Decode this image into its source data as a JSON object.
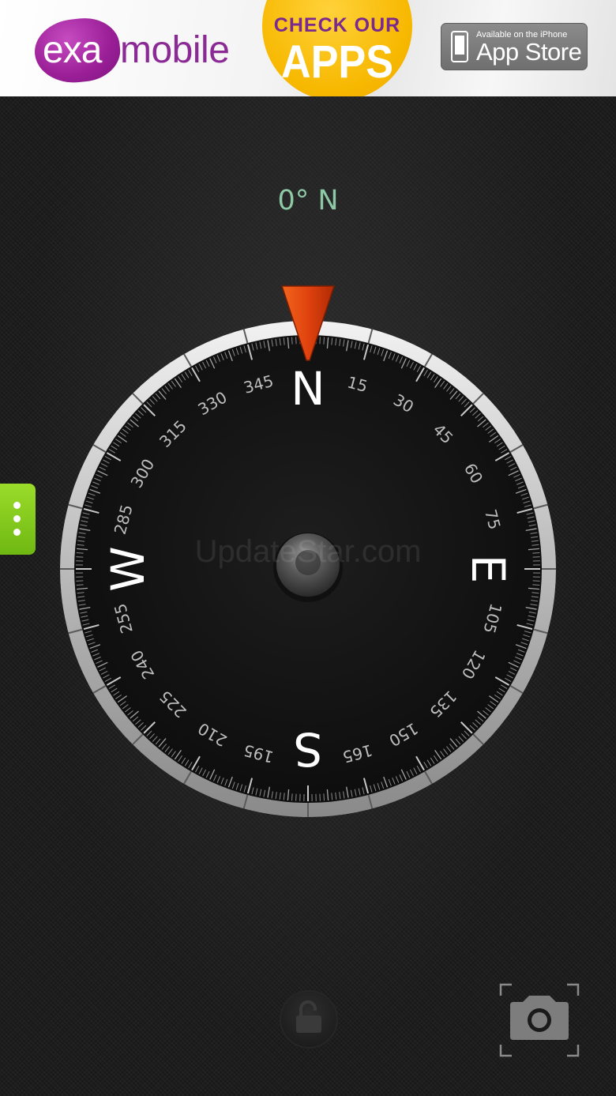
{
  "ad": {
    "brand_exa": "exa",
    "brand_mobile": "mobile",
    "cta_line1": "CHECK OUR",
    "cta_line2": "APPS",
    "store_small": "Available on the iPhone",
    "store_big": "App Store"
  },
  "compass": {
    "heading_text": "0° N",
    "watermark": "UpdateStar.com",
    "cardinals": [
      "N",
      "E",
      "S",
      "W"
    ],
    "degree_labels": [
      "15",
      "30",
      "45",
      "60",
      "75",
      "105",
      "120",
      "135",
      "150",
      "165",
      "195",
      "210",
      "225",
      "240",
      "255",
      "285",
      "300",
      "315",
      "330",
      "345"
    ],
    "colors": {
      "heading": "#8ec9a6",
      "needle": "#e0420e",
      "menu_handle": "#8bcf22"
    }
  },
  "controls": {
    "menu_icon": "more-vertical-icon",
    "lock_icon": "unlock-icon",
    "camera_icon": "camera-icon"
  }
}
